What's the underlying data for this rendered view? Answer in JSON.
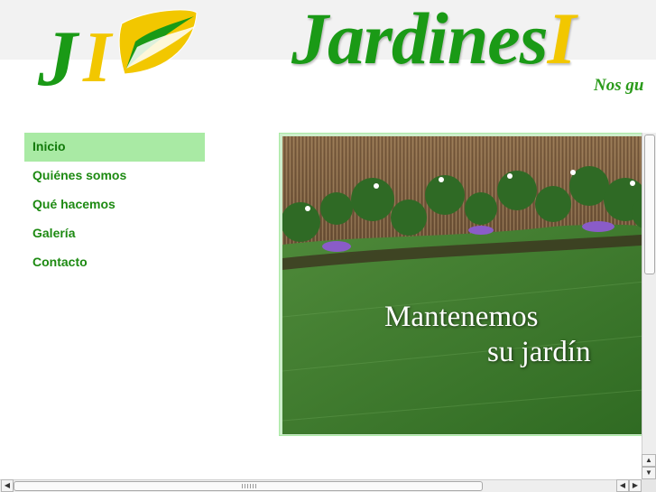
{
  "header": {
    "brand_main": "Jardines",
    "brand_accent": "I",
    "tagline": "Nos gu",
    "logo_letters": {
      "first": "J",
      "second": "I"
    }
  },
  "nav": {
    "items": [
      {
        "label": "Inicio",
        "active": true
      },
      {
        "label": "Quiénes somos",
        "active": false
      },
      {
        "label": "Qué hacemos",
        "active": false
      },
      {
        "label": "Galería",
        "active": false
      },
      {
        "label": "Contacto",
        "active": false
      }
    ]
  },
  "hero": {
    "line1": "Mantenemos",
    "line2": "su jardín"
  },
  "colors": {
    "brand_green": "#1a9a16",
    "brand_yellow": "#f2c700",
    "nav_active_bg": "#a9eaa4",
    "nav_text": "#1d8a12"
  },
  "icons": {
    "scroll_up": "▲",
    "scroll_down": "▼",
    "scroll_left": "◀",
    "scroll_right": "▶"
  }
}
